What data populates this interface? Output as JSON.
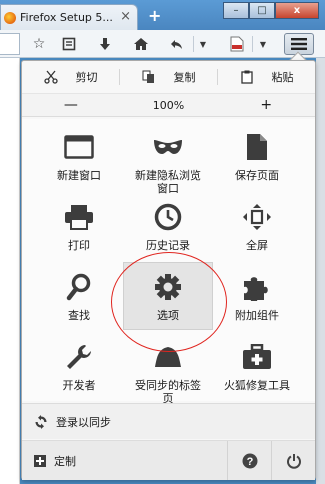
{
  "tab": {
    "title": "Firefox Setup 5...",
    "close": "×",
    "new_tab": "+"
  },
  "window_controls": {
    "minimize": "–",
    "maximize": "□",
    "close": "x"
  },
  "edit": {
    "cut": "剪切",
    "copy": "复制",
    "paste": "粘贴"
  },
  "zoom": {
    "out": "—",
    "level": "100%",
    "in": "+"
  },
  "grid": [
    {
      "label": "新建窗口",
      "icon": "new-window-icon"
    },
    {
      "label": "新建隐私浏览\n窗口",
      "icon": "private-mask-icon"
    },
    {
      "label": "保存页面",
      "icon": "save-page-icon"
    },
    {
      "label": "打印",
      "icon": "print-icon"
    },
    {
      "label": "历史记录",
      "icon": "history-clock-icon"
    },
    {
      "label": "全屏",
      "icon": "fullscreen-icon"
    },
    {
      "label": "查找",
      "icon": "find-icon"
    },
    {
      "label": "选项",
      "icon": "options-gear-icon"
    },
    {
      "label": "附加组件",
      "icon": "addons-puzzle-icon"
    },
    {
      "label": "开发者",
      "icon": "developer-wrench-icon"
    },
    {
      "label": "受同步的标签\n页",
      "icon": "synced-tabs-icon"
    },
    {
      "label": "火狐修复工具",
      "icon": "repair-toolkit-icon"
    }
  ],
  "sync": {
    "label": "登录以同步"
  },
  "customize": {
    "label": "定制"
  },
  "footer_buttons": {
    "help": "?",
    "quit": "⏻"
  },
  "colors": {
    "annotation_ring": "#e0251f",
    "title_bar": "#4a86c0",
    "icon": "#3d3d3d"
  }
}
